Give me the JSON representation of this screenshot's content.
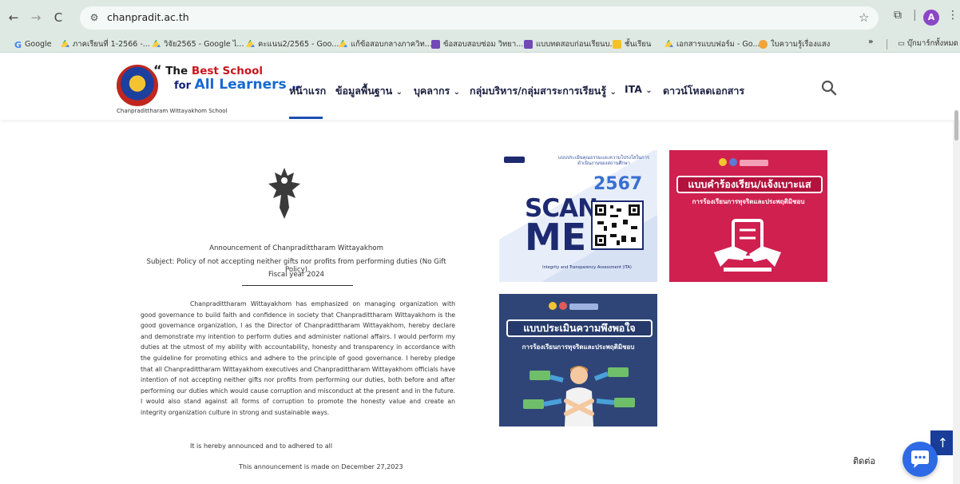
{
  "browser": {
    "back": "←",
    "forward": "→",
    "reload": "C",
    "url": "chanpradit.ac.th",
    "avatar": "A",
    "bookmarks": [
      {
        "icon": "google-icon",
        "label": "Google"
      },
      {
        "icon": "drive-icon",
        "label": "ภาคเรียนที่ 1-2566 -..."
      },
      {
        "icon": "drive-icon",
        "label": "วิจัย2565 - Google ไ..."
      },
      {
        "icon": "drive-icon",
        "label": "คะแนน2/2565 - Goo..."
      },
      {
        "icon": "drive-icon",
        "label": "แก้ข้อสอบกลางภาควิท..."
      },
      {
        "icon": "form-icon",
        "label": "ข้อสอบสอบซ่อม วิทยา..."
      },
      {
        "icon": "form-icon",
        "label": "แบบทดสอบก่อนเรียนบ..."
      },
      {
        "icon": "sheet-icon",
        "label": "ชั้นเรียน"
      },
      {
        "icon": "drive-icon",
        "label": "เอกสารแบบฟอร์ม - Go..."
      },
      {
        "icon": "gear-icon",
        "label": "ใบความรู้เรื่องแสง"
      }
    ],
    "more": "»",
    "all_bookmarks": "บุ๊กมาร์กทั้งหมด"
  },
  "site": {
    "slogan_line1_quote": "“",
    "slogan_line1_a": "The ",
    "slogan_line1_b": "Best School",
    "slogan_line2_a": "for ",
    "slogan_line2_b": "All Learners",
    "slogan_line2_quote": "„",
    "school_name": "Chanpradittharam Wittayakhom School",
    "menu": [
      {
        "label": "หน้าแรก",
        "dropdown": false
      },
      {
        "label": "ข้อมูลพื้นฐาน",
        "dropdown": true
      },
      {
        "label": "บุคลากร",
        "dropdown": true
      },
      {
        "label": "กลุ่มบริหาร/กลุ่มสาระการเรียนรู้",
        "dropdown": true
      },
      {
        "label": "ITA",
        "dropdown": true
      },
      {
        "label": "ดาวน์โหลดเอกสาร",
        "dropdown": false
      }
    ],
    "chevron": "⌄"
  },
  "announcement": {
    "title": "Announcement of Chanpradittharam Wittayakhom",
    "subject": "Subject: Policy of not accepting neither gifts nor profits from performing duties (No Gift Policy)",
    "fiscal_year": "Fiscal year 2024",
    "body": "Chanpradittharam Wittayakhom has emphasized on managing organization with good governance to build faith and confidence in society that Chanpradittharam Wittayakhom is the good governance organization, I as the Director of Chanpradittharam Wittayakhom, hereby declare and demonstrate my intention to perform duties and administer national affairs. I would perform my duties at the utmost of my ability with accountability, honesty and transparency in accordance with the guideline for promoting ethics and adhere to the principle of good governance. I hereby pledge that all Chanpradittharam Wittayakhom executives and Chanpradittharam Wittayakhom officials have intention of not accepting neither gifts nor profits from performing our duties, both before and after performing our duties which would cause corruption and misconduct at the present and in the future. I would also stand against all forms of corruption to promote the honesty value and create an integrity organization culture in strong and sustainable ways.",
    "hereby": "It is hereby announced and to adhered to all",
    "date": "This announcement is made on December 27,2023"
  },
  "banners": {
    "scan": {
      "heading": "แบบประเมินคุณธรรมและความโปร่งใสในการดำเนินงานของสถานศึกษา",
      "year": "2567",
      "scan": "SCAN",
      "me": "ME",
      "footer": "Integrity and Transparency Assessment (ITA)"
    },
    "report": {
      "title": "แบบคำร้องเรียน/แจ้งเบาะแส",
      "subtitle": "การร้องเรียนการทุจริตและประพฤติมิชอบ"
    },
    "survey": {
      "title": "แบบประเมินความพึงพอใจ",
      "subtitle": "การร้องเรียนการทุจริตและประพฤติมิชอบ"
    }
  },
  "widgets": {
    "to_top": "↑",
    "contact": "ติดต่อ"
  },
  "colors": {
    "header_blue": "#13207a",
    "active_menu": "#1b4fb3",
    "report_banner": "#cf2050",
    "survey_banner": "#2f4578",
    "chat_button": "#2e6ae5"
  }
}
